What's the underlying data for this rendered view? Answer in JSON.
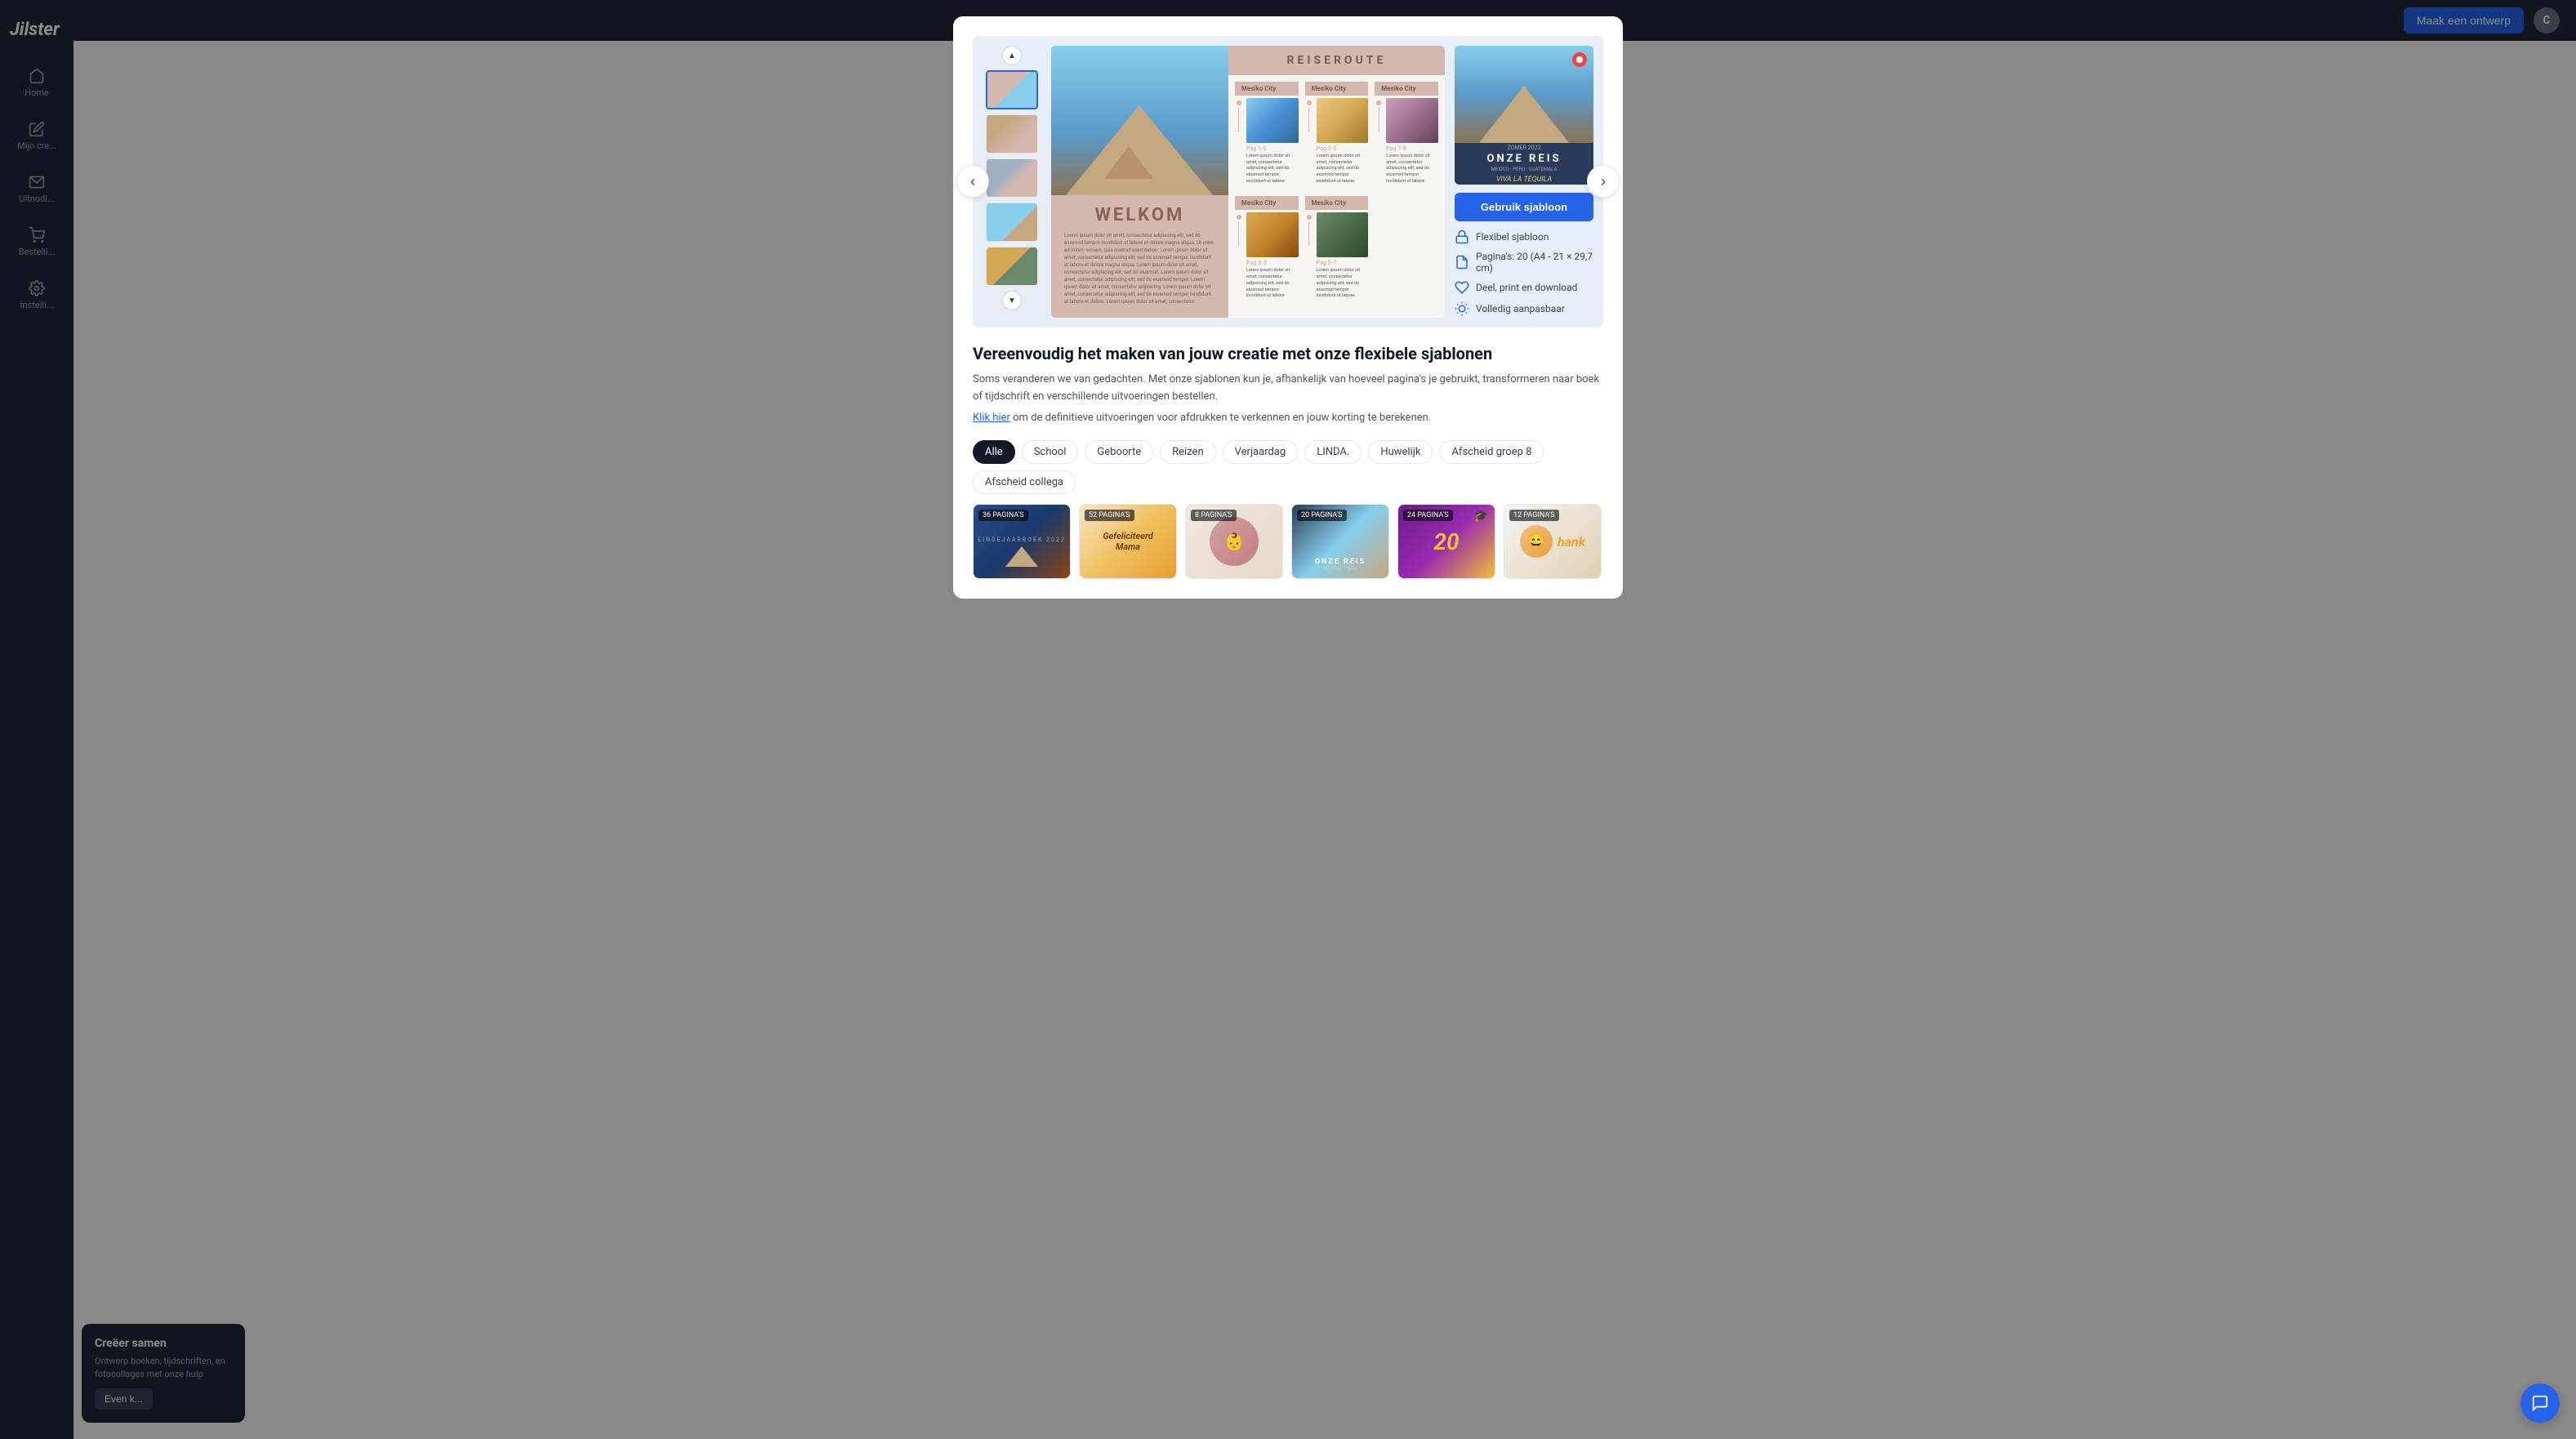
{
  "app": {
    "logo": "Jilster",
    "topbar": {
      "cta_label": "Maak een ontwerp",
      "avatar_letter": "C"
    }
  },
  "sidebar": {
    "items": [
      {
        "id": "home",
        "label": "Home",
        "icon": "home-icon"
      },
      {
        "id": "my-creations",
        "label": "Mijn cre...",
        "icon": "pencil-icon"
      },
      {
        "id": "invitations",
        "label": "Uitnodi...",
        "icon": "mail-icon"
      },
      {
        "id": "orders",
        "label": "Bestelli...",
        "icon": "cart-icon"
      },
      {
        "id": "settings",
        "label": "Instelli...",
        "icon": "gear-icon"
      }
    ]
  },
  "modal": {
    "close_label": "×",
    "preview": {
      "spread_title_left": "WELKOM",
      "route_header": "REISEROUTE",
      "cities": [
        "Mesiko City",
        "Mesiko City",
        "Mesiko City",
        "Mesiko City",
        "Mesiko City"
      ],
      "page_ranges": [
        "Pag 1-2",
        "Pag 2-3",
        "Pag 3-5",
        "Pag 5-7",
        "Pag 7-8"
      ]
    },
    "cover": {
      "top_label": "ZOMER 2023",
      "title": "ONZE REIS",
      "subtitle": "MEXICO · PERU · GUATEMALA"
    },
    "features": {
      "use_button_label": "Gebruik sjabloon",
      "items": [
        {
          "icon": "lock-icon",
          "text": "Flexibel sjabloon"
        },
        {
          "icon": "document-icon",
          "text": "Pagina's: 20 (A4 - 21 × 29,7 cm)"
        },
        {
          "icon": "heart-icon",
          "text": "Deel, print en download"
        },
        {
          "icon": "bulb-icon",
          "text": "Volledig aanpasbaar"
        }
      ]
    },
    "nav": {
      "prev_label": "‹",
      "next_label": "›"
    },
    "title": "Vereenvoudig het maken van jouw creatie met onze flexibele sjablonen",
    "description_1": "Soms veranderen we van gedachten. Met onze sjablonen kun je, afhankelijk van hoeveel pagina's je gebruikt, transformeren naar boek of tijdschrift en verschillende uitvoeringen bestellen.",
    "link_text": "Klik hier",
    "description_2": " om de definitieve uitvoeringen voor afdrukken te verkennen en jouw korting te berekenen.",
    "filters": {
      "items": [
        {
          "id": "alle",
          "label": "Alle",
          "active": true
        },
        {
          "id": "school",
          "label": "School"
        },
        {
          "id": "geboorte",
          "label": "Geboorte"
        },
        {
          "id": "reizen",
          "label": "Reizen"
        },
        {
          "id": "verjaardag",
          "label": "Verjaardag"
        },
        {
          "id": "linda",
          "label": "LINDA."
        },
        {
          "id": "huwelijk",
          "label": "Huwelijk"
        },
        {
          "id": "afscheid-groep-8",
          "label": "Afscheid groep 8"
        },
        {
          "id": "afscheid-collega",
          "label": "Afscheid collega"
        }
      ]
    },
    "templates": [
      {
        "id": 1,
        "pages_label": "36 PAGINA'S",
        "type": "boek",
        "theme": "card-1"
      },
      {
        "id": 2,
        "pages_label": "52 PAGINA'S",
        "title": "Gefeliciteerd Mama",
        "theme": "card-2"
      },
      {
        "id": 3,
        "pages_label": "8 PAGINA'S",
        "theme": "card-3"
      },
      {
        "id": 4,
        "pages_label": "20 PAGINA'S",
        "title": "ONZE REIS",
        "theme": "card-4"
      },
      {
        "id": 5,
        "pages_label": "24 PAGINA'S",
        "theme": "card-5"
      },
      {
        "id": 6,
        "pages_label": "12 PAGINA'S",
        "title": "hank",
        "theme": "card-6"
      }
    ]
  },
  "bottom_card": {
    "title": "Creëer samen",
    "description": "Ontwerp boeken, tijdschriften, en fotocollages met onze hulp",
    "button_label": "Even k..."
  },
  "chat": {
    "icon": "chat-icon"
  }
}
